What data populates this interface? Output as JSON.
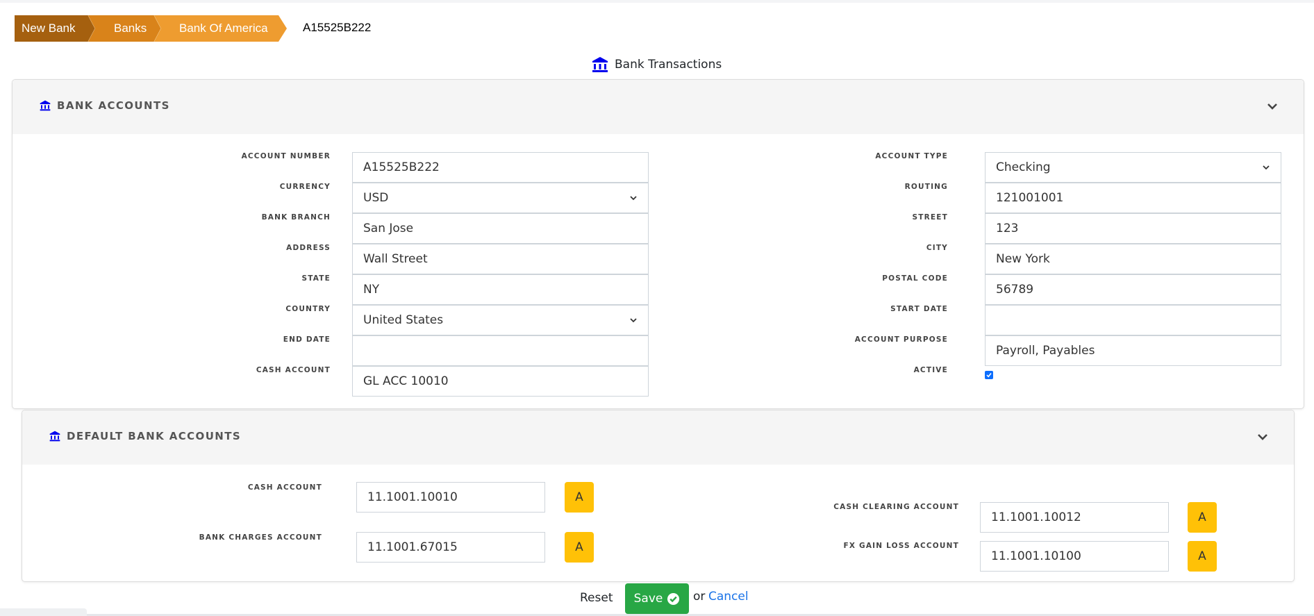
{
  "breadcrumb": {
    "items": [
      {
        "label": "New Bank",
        "color": "#A5600F"
      },
      {
        "label": "Banks",
        "color": "#D9831A"
      },
      {
        "label": "Bank Of America",
        "color": "#EE9C30"
      }
    ],
    "current": "A15525B222"
  },
  "page": {
    "section_title": "Bank Transactions",
    "icon": "bank-icon",
    "icon_color": "#0000EE"
  },
  "bank_accounts": {
    "title": "BANK ACCOUNTS",
    "left_fields": [
      {
        "label": "ACCOUNT NUMBER",
        "value": "A15525B222",
        "type": "text"
      },
      {
        "label": "CURRENCY",
        "value": "USD",
        "type": "select"
      },
      {
        "label": "BANK BRANCH",
        "value": "San Jose",
        "type": "text"
      },
      {
        "label": "ADDRESS",
        "value": "Wall Street",
        "type": "text"
      },
      {
        "label": "STATE",
        "value": "NY",
        "type": "text"
      },
      {
        "label": "COUNTRY",
        "value": "United States",
        "type": "select"
      },
      {
        "label": "END DATE",
        "value": "",
        "type": "text"
      },
      {
        "label": "CASH ACCOUNT",
        "value": "GL ACC 10010",
        "type": "text"
      }
    ],
    "right_fields": [
      {
        "label": "ACCOUNT TYPE",
        "value": "Checking",
        "type": "select"
      },
      {
        "label": "ROUTING",
        "value": "121001001",
        "type": "text"
      },
      {
        "label": "STREET",
        "value": "123",
        "type": "text"
      },
      {
        "label": "CITY",
        "value": "New York",
        "type": "text"
      },
      {
        "label": "POSTAL CODE",
        "value": "56789",
        "type": "text"
      },
      {
        "label": "START DATE",
        "value": "",
        "type": "text"
      },
      {
        "label": "ACCOUNT PURPOSE",
        "value": "Payroll, Payables",
        "type": "text"
      }
    ],
    "active": {
      "label": "ACTIVE",
      "checked": true
    }
  },
  "default_bank_accounts": {
    "title": "DEFAULT BANK ACCOUNTS",
    "button_label": "A",
    "button_color": "#FFC107",
    "left_fields": [
      {
        "label": "CASH ACCOUNT",
        "value": "11.1001.10010"
      },
      {
        "label": "BANK CHARGES ACCOUNT",
        "value": "11.1001.67015"
      }
    ],
    "right_fields": [
      {
        "label": "CASH CLEARING ACCOUNT",
        "value": "11.1001.10012"
      },
      {
        "label": "FX GAIN LOSS ACCOUNT",
        "value": "11.1001.10100"
      }
    ]
  },
  "footer": {
    "reset_label": "Reset",
    "save_label": "Save",
    "save_color": "#28A745",
    "or_text": "or",
    "cancel_label": "Cancel"
  }
}
